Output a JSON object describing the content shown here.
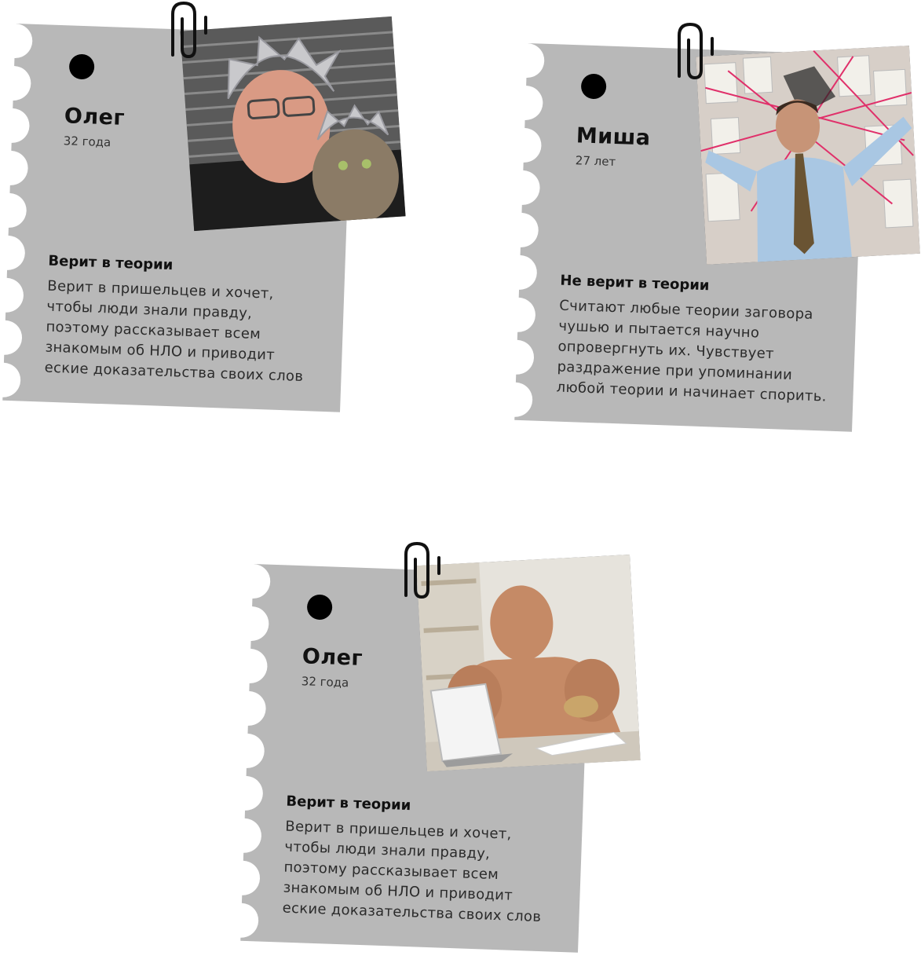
{
  "cards": [
    {
      "name": "Олег",
      "age": "32 года",
      "heading": "Верит в теории",
      "lines": [
        "Верит в пришельцев и хочет,",
        "чтобы люди знали правду,",
        "поэтому рассказывает всем",
        "знакомым об НЛО и приводит",
        "еские доказательства своих слов"
      ]
    },
    {
      "name": "Миша",
      "age": "27 лет",
      "heading": "Не верит в теории",
      "lines": [
        "Считают любые теории заговора",
        "чушью и пытается научно",
        "опровергнуть их. Чувствует",
        "раздражение при упоминании",
        "любой теории и начинает спорить."
      ]
    },
    {
      "name": "Олег",
      "age": "32 года",
      "heading": "Верит в теории",
      "lines": [
        "Верит в пришельцев и хочет,",
        "чтобы люди знали правду,",
        "поэтому рассказывает всем",
        "знакомым об НЛО и приводит",
        "еские доказательства своих слов"
      ]
    }
  ],
  "colors": {
    "paper": "#b8b8b8",
    "dot": "#000000",
    "clip": "#111111"
  },
  "icons": [
    "paperclip-icon",
    "pin-dot-icon"
  ]
}
